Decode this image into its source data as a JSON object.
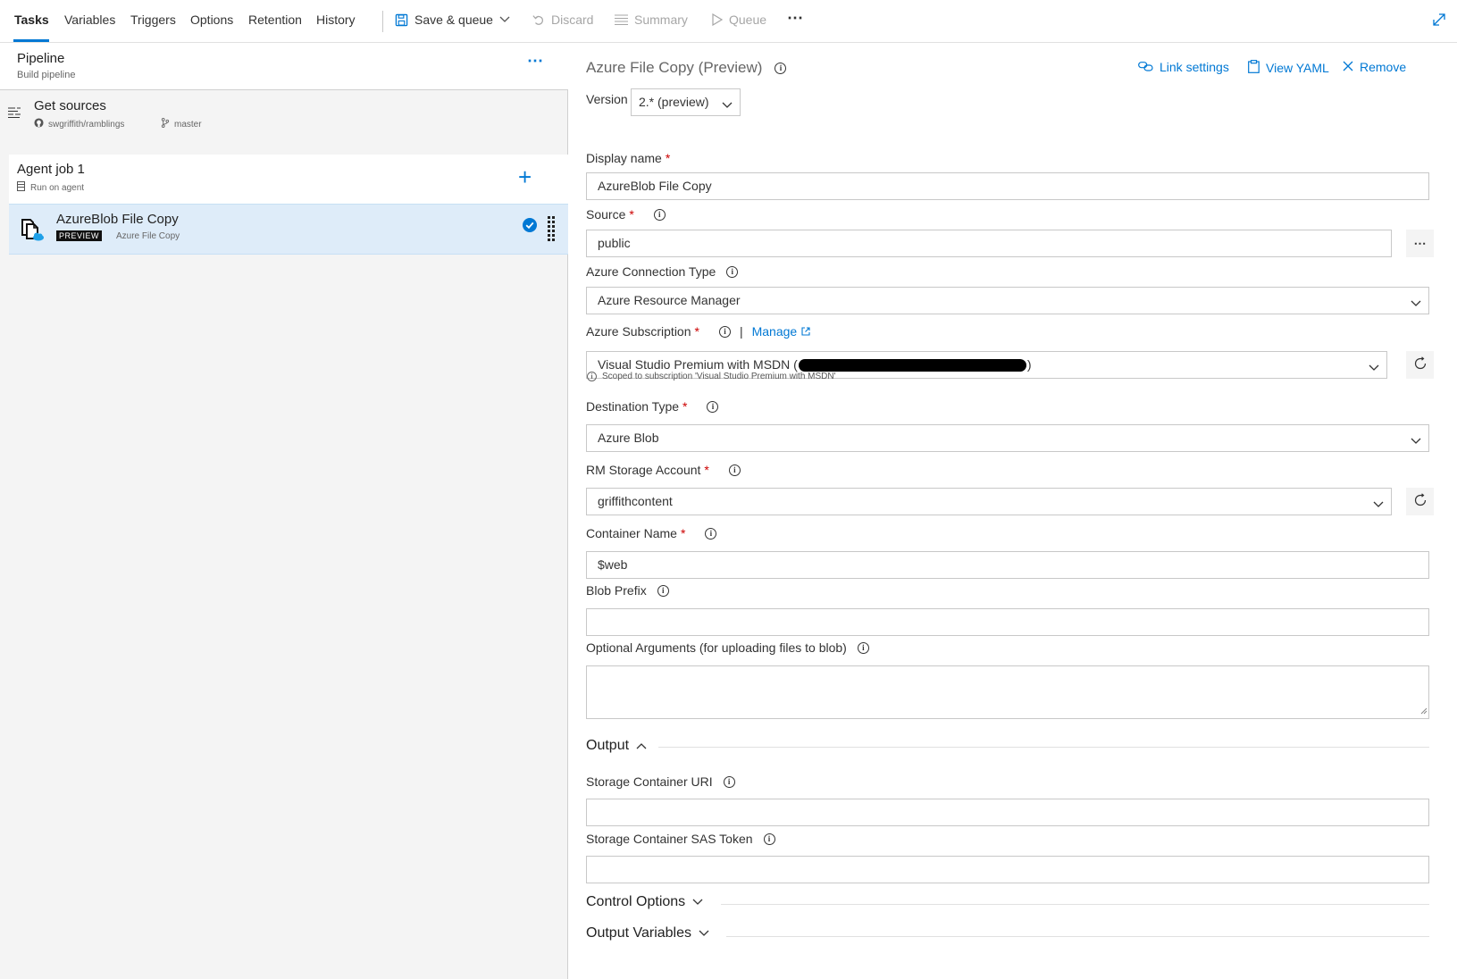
{
  "tabs": [
    {
      "label": "Tasks"
    },
    {
      "label": "Variables"
    },
    {
      "label": "Triggers"
    },
    {
      "label": "Options"
    },
    {
      "label": "Retention"
    },
    {
      "label": "History"
    }
  ],
  "toolbar": {
    "save_queue": "Save & queue",
    "discard": "Discard",
    "summary": "Summary",
    "queue": "Queue",
    "more": "⋯"
  },
  "pipeline": {
    "title": "Pipeline",
    "subtitle": "Build pipeline",
    "more": "⋯"
  },
  "sources": {
    "title": "Get sources",
    "repo": "swgriffith/ramblings",
    "branch": "master"
  },
  "agent_job": {
    "title": "Agent job 1",
    "subtitle": "Run on agent",
    "add": "+"
  },
  "task": {
    "title": "AzureBlob File Copy",
    "badge": "PREVIEW",
    "subtitle": "Azure File Copy"
  },
  "panel": {
    "title": "Azure File Copy (Preview)",
    "link_settings": "Link settings",
    "view_yaml": "View YAML",
    "remove": "Remove",
    "version_label": "Version",
    "version_value": "2.* (preview)",
    "display_name_label": "Display name",
    "display_name_value": "AzureBlob File Copy",
    "source_label": "Source",
    "source_value": "public",
    "connection_type_label": "Azure Connection Type",
    "connection_type_value": "Azure Resource Manager",
    "subscription_label": "Azure Subscription",
    "manage": "Manage",
    "subscription_value_prefix": "Visual Studio Premium with MSDN (",
    "subscription_value_suffix": ")",
    "scope_note": "Scoped to subscription 'Visual Studio Premium with MSDN'",
    "destination_type_label": "Destination Type",
    "destination_type_value": "Azure Blob",
    "storage_account_label": "RM Storage Account",
    "storage_account_value": "griffithcontent",
    "container_name_label": "Container Name",
    "container_name_value": "$web",
    "blob_prefix_label": "Blob Prefix",
    "blob_prefix_value": "",
    "optional_args_label": "Optional Arguments (for uploading files to blob)",
    "optional_args_value": "",
    "output_section": "Output",
    "storage_uri_label": "Storage Container URI",
    "storage_uri_value": "",
    "sas_token_label": "Storage Container SAS Token",
    "sas_token_value": "",
    "control_options": "Control Options",
    "output_variables": "Output Variables"
  },
  "colors": {
    "accent": "#0078d4",
    "selected_row": "#deecf9",
    "required": "#cc0000"
  }
}
